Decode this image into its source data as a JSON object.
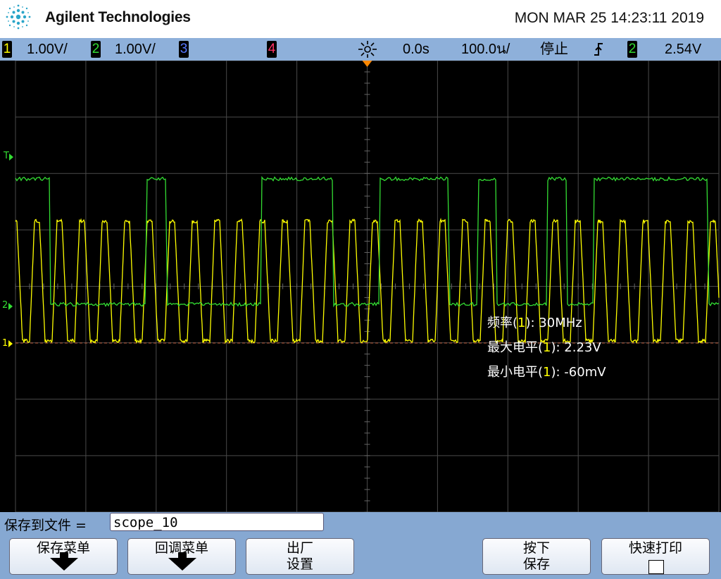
{
  "header": {
    "brand": "Agilent Technologies",
    "datetime": "MON MAR 25 14:23:11 2019",
    "logo_icon": "agilent-spark-logo"
  },
  "status_bar": {
    "ch1_num": "1",
    "ch1_scale": "1.00V/",
    "ch2_num": "2",
    "ch2_scale": "1.00V/",
    "ch3_num": "3",
    "ch4_num": "4",
    "delay": "0.0s",
    "timebase": "100.0น/",
    "run_state": "停止",
    "trigger_icon": "rising-edge-icon",
    "trigger_source": "2",
    "trigger_level": "2.54V"
  },
  "colors": {
    "ch1": "#ffff00",
    "ch2": "#33dd33",
    "ch3": "#5577ff",
    "ch4": "#ff3366",
    "grid": "#4a4a4a",
    "status_bg": "#8eb0da",
    "softkey_bg": "#86a8d2"
  },
  "markers": {
    "trigger_marker": "T",
    "ch2_marker": "2",
    "ch1_marker": "1"
  },
  "measurements": {
    "freq_label": "频率(",
    "freq_ch": "1",
    "freq_value": "): 30MHz",
    "vmax_label": "最大电平(",
    "vmax_ch": "1",
    "vmax_value": "): 2.23V",
    "vmin_label": "最小电平(",
    "vmin_ch": "1",
    "vmin_value": "): -60mV"
  },
  "file": {
    "label": "保存到文件 =",
    "value": "scope_10"
  },
  "softkeys": [
    {
      "line1": "保存菜单",
      "line2": ""
    },
    {
      "line1": "回调菜单",
      "line2": ""
    },
    {
      "line1": "出厂",
      "line2": "设置"
    },
    {
      "line1": "按下",
      "line2": "保存"
    },
    {
      "line1": "快速打印",
      "line2": ""
    }
  ]
}
